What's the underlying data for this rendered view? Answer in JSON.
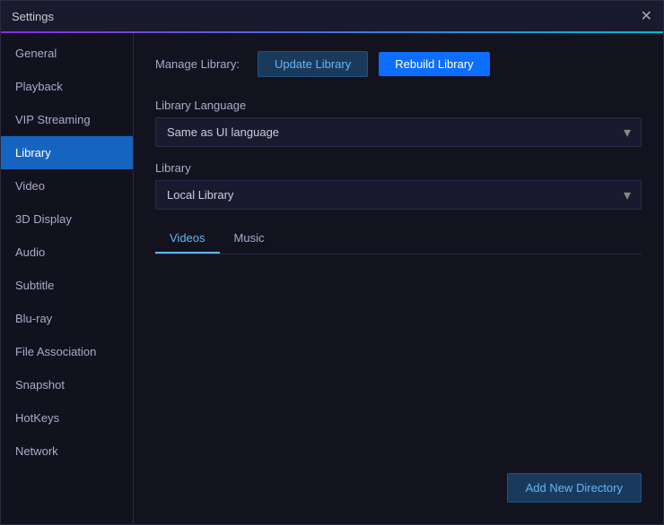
{
  "window": {
    "title": "Settings",
    "close_symbol": "✕"
  },
  "sidebar": {
    "items": [
      {
        "id": "general",
        "label": "General",
        "active": false
      },
      {
        "id": "playback",
        "label": "Playback",
        "active": false
      },
      {
        "id": "vip-streaming",
        "label": "VIP Streaming",
        "active": false
      },
      {
        "id": "library",
        "label": "Library",
        "active": true
      },
      {
        "id": "video",
        "label": "Video",
        "active": false
      },
      {
        "id": "3d-display",
        "label": "3D Display",
        "active": false
      },
      {
        "id": "audio",
        "label": "Audio",
        "active": false
      },
      {
        "id": "subtitle",
        "label": "Subtitle",
        "active": false
      },
      {
        "id": "blu-ray",
        "label": "Blu-ray",
        "active": false
      },
      {
        "id": "file-association",
        "label": "File Association",
        "active": false
      },
      {
        "id": "snapshot",
        "label": "Snapshot",
        "active": false
      },
      {
        "id": "hotkeys",
        "label": "HotKeys",
        "active": false
      },
      {
        "id": "network",
        "label": "Network",
        "active": false
      }
    ]
  },
  "main": {
    "manage_library_label": "Manage Library:",
    "update_library_btn": "Update Library",
    "rebuild_library_btn": "Rebuild Library",
    "library_language_label": "Library Language",
    "library_language_value": "Same as UI language",
    "library_label": "Library",
    "library_value": "Local Library",
    "tabs": [
      {
        "id": "videos",
        "label": "Videos",
        "active": true
      },
      {
        "id": "music",
        "label": "Music",
        "active": false
      }
    ],
    "add_new_directory_btn": "Add New Directory"
  }
}
